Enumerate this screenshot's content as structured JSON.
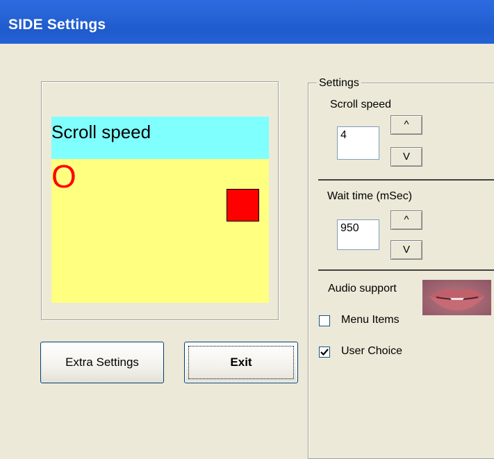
{
  "window": {
    "title": "SIDE Settings"
  },
  "preview": {
    "header_text": "Scroll speed",
    "letter": "O"
  },
  "buttons": {
    "extra_settings": "Extra Settings",
    "exit": "Exit"
  },
  "settings": {
    "legend": "Settings",
    "scroll_speed": {
      "label": "Scroll speed",
      "value": "4",
      "up": "^",
      "down": "V"
    },
    "wait_time": {
      "label": "Wait time (mSec)",
      "value": "950",
      "up": "^",
      "down": "V"
    },
    "audio_support": {
      "label": "Audio support",
      "image_icon": "lips-image"
    },
    "menu_items": {
      "label": "Menu Items",
      "checked": false
    },
    "user_choice": {
      "label": "User Choice",
      "checked": true
    }
  },
  "colors": {
    "titlebar": "#2563d8",
    "preview_header_bg": "#80ffff",
    "preview_body_bg": "#ffff80",
    "preview_accent": "#ff0000"
  }
}
